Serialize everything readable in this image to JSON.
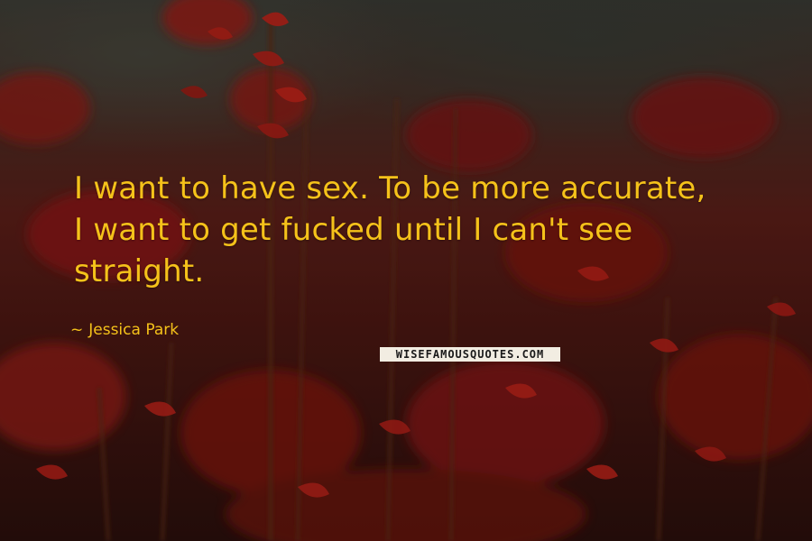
{
  "quote": {
    "text": "I want to have sex. To be more accurate,\nI want to get fucked until I can't see\nstraight."
  },
  "author": {
    "dash": "~",
    "name": "Jessica Park"
  },
  "watermark": {
    "text": "WISEFAMOUSQUOTES.COM"
  },
  "colors": {
    "quote_text": "#f5c21a",
    "background_red": "#5a1e18"
  }
}
